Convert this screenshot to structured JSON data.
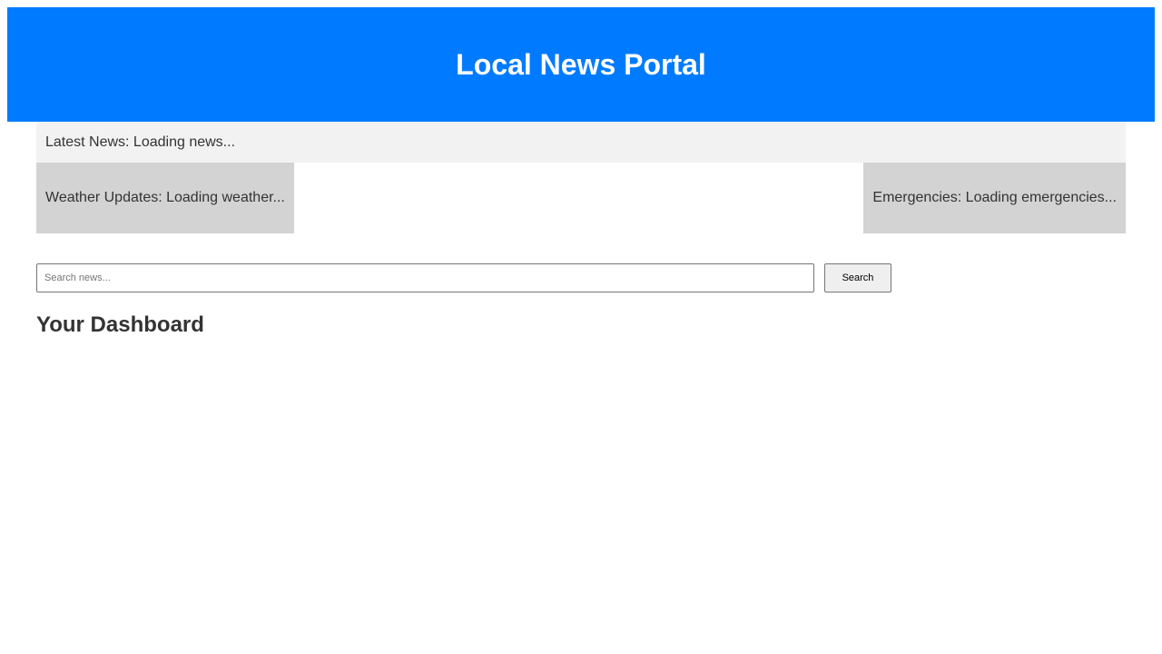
{
  "header": {
    "title": "Local News Portal",
    "background_color": "#007bff"
  },
  "latest_news": {
    "text": "Latest News: Loading news..."
  },
  "weather": {
    "text": "Weather Updates: Loading weather..."
  },
  "emergencies": {
    "text": "Emergencies: Loading emergencies..."
  },
  "search": {
    "placeholder": "Search news...",
    "value": "",
    "button_label": "Search"
  },
  "dashboard": {
    "title": "Your Dashboard"
  }
}
